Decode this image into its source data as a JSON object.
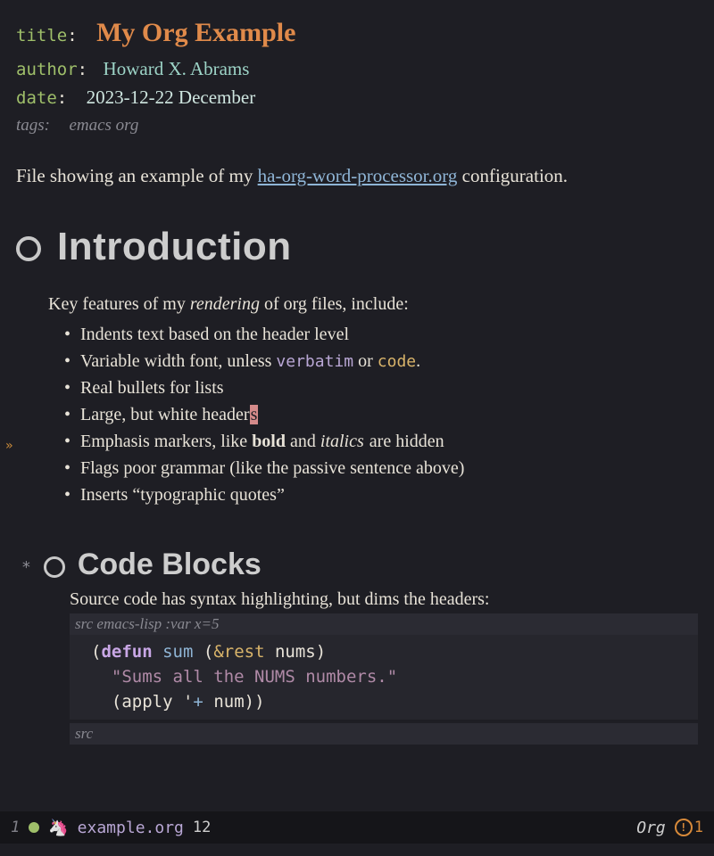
{
  "meta": {
    "title_key": "title",
    "title_val": "My Org Example",
    "author_key": "author",
    "author_val": "Howard X. Abrams",
    "date_key": "date",
    "date_val": "2023-12-22 December",
    "tags_key": "tags:",
    "tags_val": "emacs org"
  },
  "intro": {
    "before_link": "File showing an example of my ",
    "link_text": "ha-org-word-processor.org",
    "after_link": " configuration."
  },
  "h1": "Introduction",
  "features_lead_a": "Key features of my ",
  "features_lead_em": "rendering",
  "features_lead_b": " of org files, include:",
  "bullets": {
    "b1": "Indents text based on the header level",
    "b2a": "Variable width font, unless ",
    "b2_verbatim": "verbatim",
    "b2_mid": " or ",
    "b2_code": "code",
    "b2_end": ".",
    "b3": "Real bullets for lists",
    "b4a": "Large, but white header",
    "b4_cursor": "s",
    "b5a": "Emphasis markers, like ",
    "b5_bold": "bold",
    "b5_mid": " and ",
    "b5_italics": "italics",
    "b5_end": " are hidden",
    "b6": "Flags poor grammar (like the passive sentence above)",
    "b7": "Inserts “typographic quotes”"
  },
  "h2_star": "*",
  "h2": "Code Blocks",
  "src": {
    "desc": "Source code has syntax highlighting, but dims the headers:",
    "header_label": "src",
    "header_lang": " emacs-lisp :var x=5",
    "line1_open": "(",
    "line1_defun": "defun",
    "line1_sp1": " ",
    "line1_name": "sum",
    "line1_sp2": " (",
    "line1_rest": "&rest",
    "line1_sp3": " ",
    "line1_arg": "nums",
    "line1_close": ")",
    "line2": "  \"Sums all the NUMS numbers.\"",
    "line3a": "  (",
    "line3_apply": "apply",
    "line3_mid": " '",
    "line3_plus": "+",
    "line3_sp": " ",
    "line3_num": "num",
    "line3_close": "))",
    "footer": "src"
  },
  "fringe": "»",
  "modeline": {
    "left_num": "1",
    "unicorn": "🦄",
    "filename": "example.org",
    "line": "12",
    "mode": "Org",
    "warn_count": "1"
  }
}
